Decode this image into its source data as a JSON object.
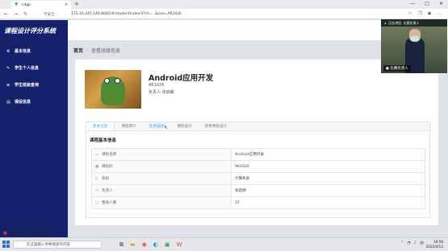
{
  "browser": {
    "tab_title": "cdgp",
    "address_secure_label": "不安全",
    "url": "172.16.245.146:8082/#/studentIndex/3?id=...&cno=AK1026",
    "new_tab_glyph": "+",
    "icons": [
      "back-icon",
      "forward-icon",
      "refresh-icon",
      "star-icon",
      "menu-icon"
    ]
  },
  "sidebar": {
    "brand": "课程设计评分系统",
    "items": [
      {
        "label": "基本信息",
        "icon": "gear-icon"
      },
      {
        "label": "学生个人信息",
        "icon": "user-icon"
      },
      {
        "label": "学生班级查询",
        "icon": "search-icon"
      },
      {
        "label": "课设信息",
        "icon": "list-icon"
      }
    ]
  },
  "breadcrumb": {
    "home": "首页",
    "separator": "/",
    "current": "查看班级信息"
  },
  "course": {
    "title": "Android应用开发",
    "code": "AK1026",
    "owner": "负责人:张启朗"
  },
  "tabs": [
    {
      "label": "基本信息",
      "state": "active"
    },
    {
      "label": "课程简介",
      "state": "normal"
    },
    {
      "label": "任务描述",
      "state": "hover"
    },
    {
      "label": "课程设计",
      "state": "normal"
    },
    {
      "label": "优秀课程设计",
      "state": "normal"
    }
  ],
  "panel": {
    "title": "课程基本信息",
    "rows": [
      {
        "key": "课程名称",
        "icon": "book-icon",
        "value": "Android应用开发"
      },
      {
        "key": "课程码",
        "icon": "code-icon",
        "value": "AK1026"
      },
      {
        "key": "系别",
        "icon": "building-icon",
        "value": "计算机系"
      },
      {
        "key": "负责人",
        "icon": "user-icon",
        "value": "张启朗"
      },
      {
        "key": "整体人数",
        "icon": "people-icon",
        "value": "37"
      }
    ]
  },
  "video": {
    "bar_text": "正在讲话: 比赛负责人",
    "name_label": "比赛负责人"
  },
  "share": {
    "label": "比赛负责人的屏幕共享",
    "search_placeholder": "在这里输入你要搜索的内容"
  },
  "taskbar": {
    "time": "16:58",
    "date": "2022/4/12"
  },
  "colors": {
    "sidebar": "#15226b",
    "accent": "#409eff",
    "background": "#dfe3e8"
  }
}
